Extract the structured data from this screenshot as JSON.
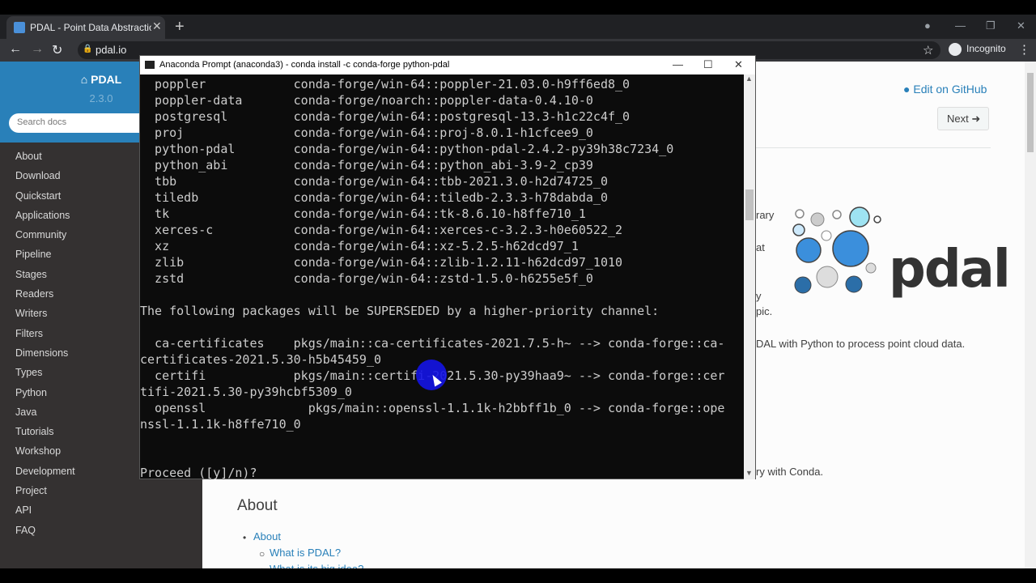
{
  "browser": {
    "tab_title": "PDAL - Point Data Abstraction Li",
    "tab_close": "✕",
    "new_tab": "+",
    "url": "pdal.io",
    "incognito_label": "Incognito",
    "star_icon": "☆",
    "menu_icon": "⋮",
    "back_icon": "←",
    "forward_icon": "→",
    "reload_icon": "↻",
    "win_min": "—",
    "win_max": "❐",
    "win_close": "✕",
    "profile_icon": "●"
  },
  "sidebar": {
    "brand": "PDAL",
    "version": "2.3.0",
    "search_placeholder": "Search docs",
    "items": [
      "About",
      "Download",
      "Quickstart",
      "Applications",
      "Community",
      "Pipeline",
      "Stages",
      "Readers",
      "Writers",
      "Filters",
      "Dimensions",
      "Types",
      "Python",
      "Java",
      "Tutorials",
      "Workshop",
      "Development",
      "Project",
      "API",
      "FAQ"
    ]
  },
  "content": {
    "edit_github": "Edit on GitHub",
    "next_button": "Next",
    "frag_rary": "rary",
    "frag_at": "at",
    "frag_y": "y",
    "frag_pic": "pic.",
    "frag_python": "DAL with Python to process point cloud data.",
    "frag_conda": "ry with Conda.",
    "about_heading": "About",
    "about_link": "About",
    "what_is": "What is PDAL?",
    "what_big_idea": "What is its big idea?",
    "logo_word": "pdal"
  },
  "terminal": {
    "title": "Anaconda Prompt (anaconda3) - conda  install -c conda-forge python-pdal",
    "min": "—",
    "max": "☐",
    "close": "✕",
    "lines": [
      "  poppler            conda-forge/win-64::poppler-21.03.0-h9ff6ed8_0",
      "  poppler-data       conda-forge/noarch::poppler-data-0.4.10-0",
      "  postgresql         conda-forge/win-64::postgresql-13.3-h1c22c4f_0",
      "  proj               conda-forge/win-64::proj-8.0.1-h1cfcee9_0",
      "  python-pdal        conda-forge/win-64::python-pdal-2.4.2-py39h38c7234_0",
      "  python_abi         conda-forge/win-64::python_abi-3.9-2_cp39",
      "  tbb                conda-forge/win-64::tbb-2021.3.0-h2d74725_0",
      "  tiledb             conda-forge/win-64::tiledb-2.3.3-h78dabda_0",
      "  tk                 conda-forge/win-64::tk-8.6.10-h8ffe710_1",
      "  xerces-c           conda-forge/win-64::xerces-c-3.2.3-h0e60522_2",
      "  xz                 conda-forge/win-64::xz-5.2.5-h62dcd97_1",
      "  zlib               conda-forge/win-64::zlib-1.2.11-h62dcd97_1010",
      "  zstd               conda-forge/win-64::zstd-1.5.0-h6255e5f_0",
      "",
      "The following packages will be SUPERSEDED by a higher-priority channel:",
      "",
      "  ca-certificates    pkgs/main::ca-certificates-2021.7.5-h~ --> conda-forge::ca-",
      "certificates-2021.5.30-h5b45459_0",
      "  certifi            pkgs/main::certifi-2021.5.30-py39haa9~ --> conda-forge::cer",
      "tifi-2021.5.30-py39hcbf5309_0",
      "  openssl              pkgs/main::openssl-1.1.1k-h2bbff1b_0 --> conda-forge::ope",
      "nssl-1.1.1k-h8ffe710_0",
      "",
      "",
      "Proceed ([y]/n)?"
    ]
  }
}
